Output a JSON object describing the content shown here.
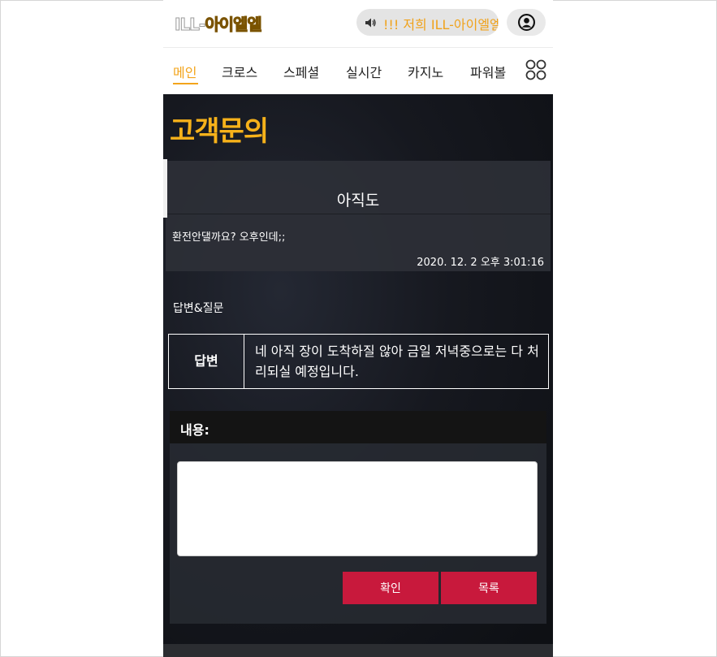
{
  "header": {
    "logo_part1": "ILL-",
    "logo_part2": "아이엘엘",
    "notice_text": "!!! 저희 ILL-아이엘엘",
    "icons": {
      "speaker": "speaker-icon",
      "user": "user-icon"
    }
  },
  "nav": {
    "items": [
      {
        "label": "메인",
        "active": true
      },
      {
        "label": "크로스"
      },
      {
        "label": "스페셜"
      },
      {
        "label": "실시간"
      },
      {
        "label": "카지노"
      },
      {
        "label": "파워볼"
      }
    ],
    "more_icon": "grid-menu-icon"
  },
  "page": {
    "title": "고객문의"
  },
  "post": {
    "title": "아직도",
    "body": "환전안댈까요? 오후인데;;",
    "date": "2020. 12. 2 오후 3:01:16"
  },
  "answer": {
    "section_label": "답변&질문",
    "head": "답변",
    "text": "네 아직 장이 도착하질 않아 금일 저녁중으로는 다 처리되실 예정입니다."
  },
  "form": {
    "label": "내용:",
    "textarea_value": "",
    "confirm_label": "확인",
    "list_label": "목록"
  },
  "colors": {
    "accent": "#f3a41b",
    "button": "#c8193c",
    "content_bg": "#0f1115"
  }
}
